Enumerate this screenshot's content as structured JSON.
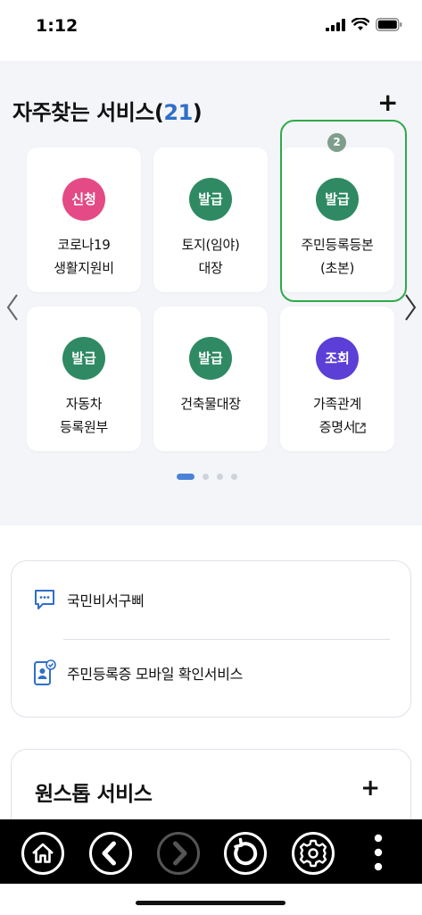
{
  "status": {
    "time": "1:12"
  },
  "favorites": {
    "title": "자주찾는 서비스",
    "count_open": "(",
    "count": "21",
    "count_close": ")",
    "add_symbol": "+",
    "highlight_number": "2",
    "items": [
      {
        "badge": "신청",
        "badge_color": "#e44a86",
        "label": "코로나19\n생활지원비"
      },
      {
        "badge": "발급",
        "badge_color": "#2f8a63",
        "label": "토지(임야)\n대장"
      },
      {
        "badge": "발급",
        "badge_color": "#2f8a63",
        "label": "주민등록등본\n(초본)"
      },
      {
        "badge": "발급",
        "badge_color": "#2f8a63",
        "label": "자동차\n등록원부"
      },
      {
        "badge": "발급",
        "badge_color": "#2f8a63",
        "label": "건축물대장"
      },
      {
        "badge": "조회",
        "badge_color": "#5b3fd6",
        "label": "가족관계\n증명서"
      }
    ],
    "page_indicator": {
      "total": 4,
      "current": 1
    }
  },
  "quick_links": [
    {
      "label": "국민비서구삐",
      "icon": "chat-bubble-icon"
    },
    {
      "label": "주민등록증 모바일 확인서비스",
      "icon": "mobile-id-icon"
    }
  ],
  "onestop": {
    "title": "원스톱 서비스",
    "add_symbol": "+"
  },
  "nav": {
    "buttons": [
      "home-icon",
      "back-icon",
      "forward-icon",
      "refresh-icon",
      "settings-icon",
      "more-icon"
    ],
    "forward_disabled": true
  },
  "colors": {
    "accent_blue": "#2f6fc9",
    "highlight_green": "#2eaa4a",
    "issue_green": "#2f8a63",
    "apply_pink": "#e44a86",
    "inquiry_purple": "#5b3fd6"
  }
}
